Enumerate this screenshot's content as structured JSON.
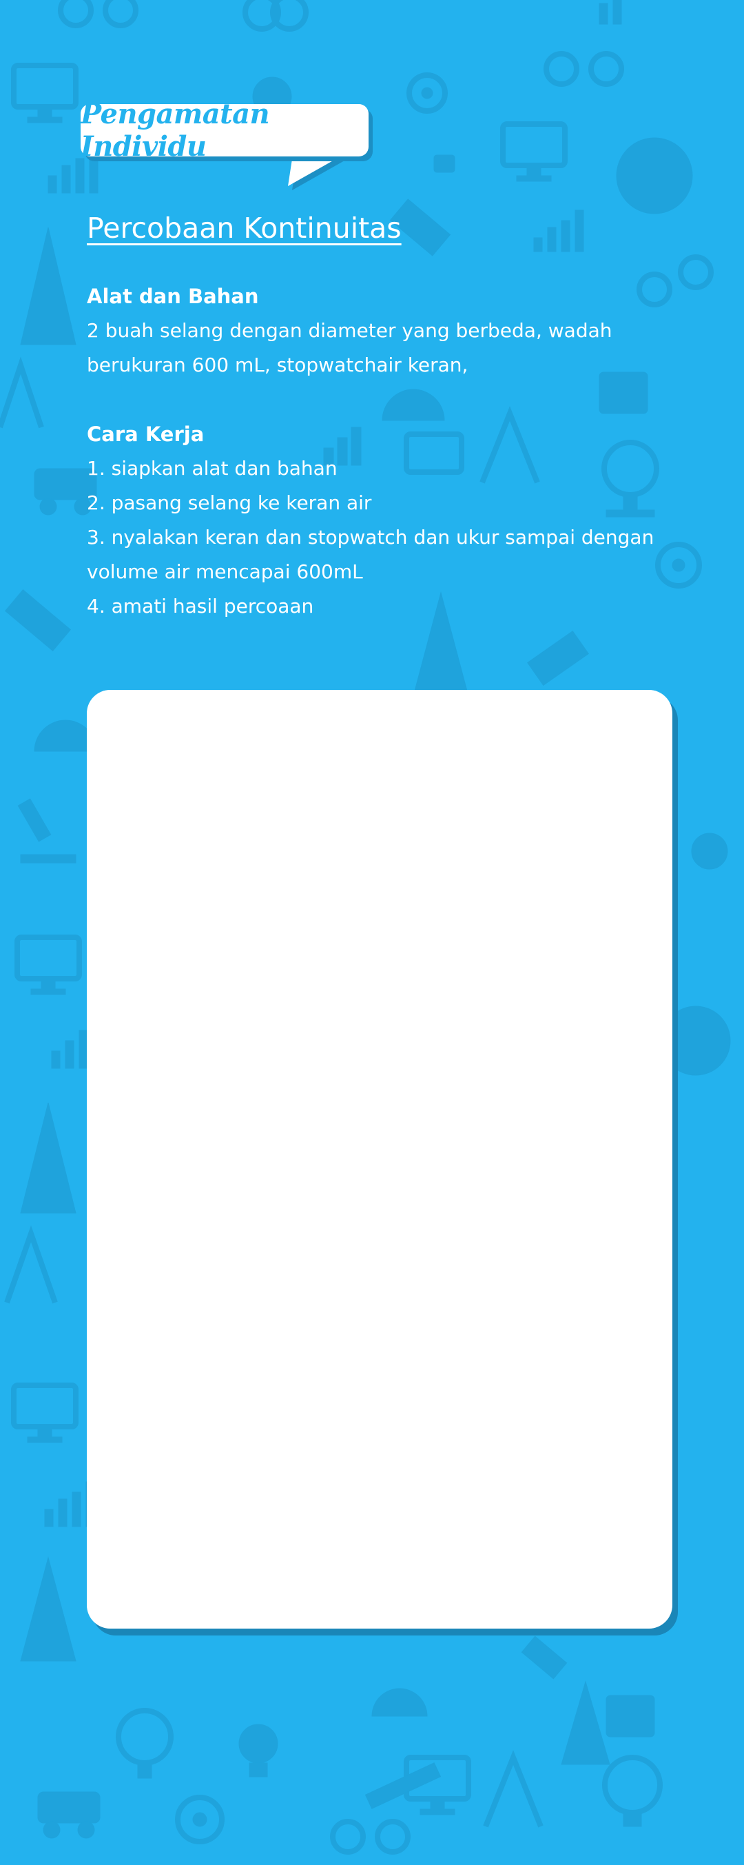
{
  "header": {
    "bubble_title": "Pengamatan Individu"
  },
  "main": {
    "title": "Percobaan Kontinuitas",
    "materials": {
      "heading": "Alat dan Bahan",
      "text": "2 buah selang dengan diameter yang berbeda, wadah berukuran 600 mL, stopwatchair keran,"
    },
    "procedure": {
      "heading": "Cara Kerja",
      "steps": [
        "1.  siapkan alat dan bahan",
        "2. pasang selang ke keran air",
        "3. nyalakan keran dan stopwatch dan ukur sampai dengan volume air mencapai 600mL",
        "4. amati hasil percoaan"
      ]
    }
  },
  "colors": {
    "background": "#23b2ee",
    "pattern": "#1fa3dc",
    "panel": "#ffffff",
    "panel_shadow": "#1a86b8",
    "accent_text": "#23b2ee"
  },
  "background_icons": [
    "monitor-icon",
    "gear-icon",
    "bar-chart-icon",
    "telescope-icon",
    "satellite-icon",
    "globe-icon",
    "compass-icon",
    "glasses-icon",
    "lightbulb-icon",
    "cone-icon",
    "calendar-icon",
    "microscope-icon"
  ]
}
